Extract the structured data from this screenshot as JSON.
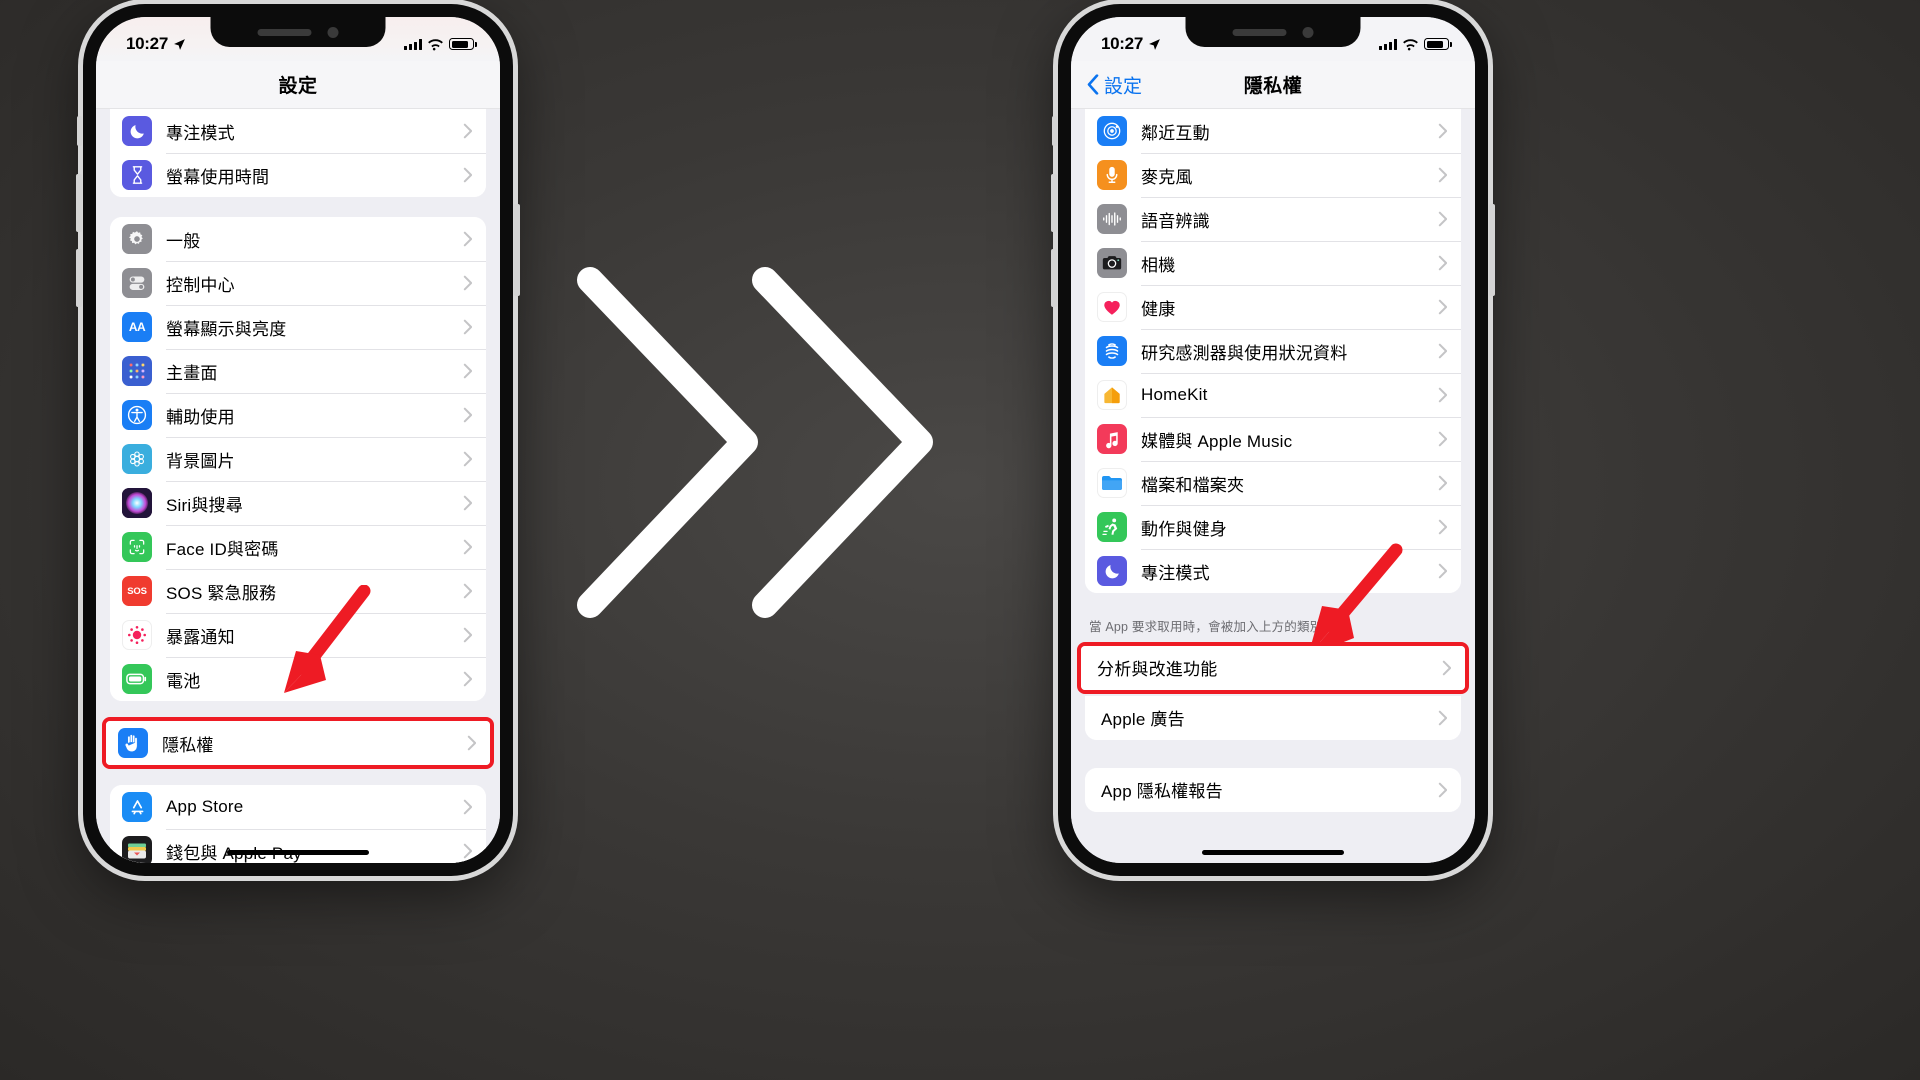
{
  "scene": {
    "background_color": "#3a3836",
    "highlight_color": "#ee1b24",
    "arrow_color": "#ee1b24",
    "chevron_color": "#ffffff"
  },
  "left_phone": {
    "status_bar": {
      "time": "10:27",
      "location_icon": "location-arrow-icon",
      "signal_icon": "signal-bars-icon",
      "wifi_icon": "wifi-icon",
      "battery_icon": "battery-icon"
    },
    "nav": {
      "title": "設定"
    },
    "groups": [
      {
        "rows": [
          {
            "label": "專注模式",
            "icon": "focus-moon-icon",
            "icon_bg": "#5a5ae0"
          },
          {
            "label": "螢幕使用時間",
            "icon": "screen-time-hourglass-icon",
            "icon_bg": "#5a5ae0"
          }
        ]
      },
      {
        "rows": [
          {
            "label": "一般",
            "icon": "gear-icon",
            "icon_bg": "#8e8e93"
          },
          {
            "label": "控制中心",
            "icon": "control-center-toggles-icon",
            "icon_bg": "#8e8e93"
          },
          {
            "label": "螢幕顯示與亮度",
            "icon": "display-brightness-aa-icon",
            "icon_bg": "#1a7ef5"
          },
          {
            "label": "主畫面",
            "icon": "home-screen-grid-icon",
            "icon_bg": "#3a5fd0"
          },
          {
            "label": "輔助使用",
            "icon": "accessibility-icon",
            "icon_bg": "#1a7ef5"
          },
          {
            "label": "背景圖片",
            "icon": "wallpaper-flower-icon",
            "icon_bg": "#3aaede"
          },
          {
            "label": "Siri與搜尋",
            "icon": "siri-orb-icon",
            "icon_bg": "#22143a"
          },
          {
            "label": "Face ID與密碼",
            "icon": "face-id-icon",
            "icon_bg": "#34c759"
          },
          {
            "label": "SOS 緊急服務",
            "icon": "sos-icon",
            "icon_bg": "#f03b2f"
          },
          {
            "label": "暴露通知",
            "icon": "exposure-notification-icon",
            "icon_bg": "#ffffff"
          },
          {
            "label": "電池",
            "icon": "battery-green-icon",
            "icon_bg": "#34c759"
          }
        ]
      },
      {
        "highlighted": true,
        "rows": [
          {
            "label": "隱私權",
            "icon": "privacy-hand-icon",
            "icon_bg": "#1a7ef5"
          }
        ]
      },
      {
        "rows": [
          {
            "label": "App Store",
            "icon": "app-store-icon",
            "icon_bg": "#1a8cf5"
          },
          {
            "label": "錢包與 Apple Pay",
            "icon": "wallet-icon",
            "icon_bg": "#1c1c1e"
          }
        ]
      }
    ]
  },
  "right_phone": {
    "status_bar": {
      "time": "10:27",
      "location_icon": "location-arrow-icon",
      "signal_icon": "signal-bars-icon",
      "wifi_icon": "wifi-icon",
      "battery_icon": "battery-icon"
    },
    "nav": {
      "back_label": "設定",
      "title": "隱私權",
      "back_icon": "chevron-left-icon"
    },
    "groups": [
      {
        "rows": [
          {
            "label": "鄰近互動",
            "icon": "nearby-interactions-icon",
            "icon_bg": "#1a7ef5"
          },
          {
            "label": "麥克風",
            "icon": "microphone-icon",
            "icon_bg": "#f5901e"
          },
          {
            "label": "語音辨識",
            "icon": "speech-recognition-icon",
            "icon_bg": "#8e8e93"
          },
          {
            "label": "相機",
            "icon": "camera-icon",
            "icon_bg": "#8e8e93"
          },
          {
            "label": "健康",
            "icon": "health-heart-icon",
            "icon_bg": "#ffffff"
          },
          {
            "label": "研究感測器與使用狀況資料",
            "icon": "research-sensor-icon",
            "icon_bg": "#1a7ef5"
          },
          {
            "label": "HomeKit",
            "icon": "homekit-house-icon",
            "icon_bg": "#ffffff"
          },
          {
            "label": "媒體與 Apple Music",
            "icon": "apple-music-icon",
            "icon_bg": "#f33a5a"
          },
          {
            "label": "檔案和檔案夾",
            "icon": "files-folder-icon",
            "icon_bg": "#ffffff"
          },
          {
            "label": "動作與健身",
            "icon": "motion-fitness-icon",
            "icon_bg": "#34c759"
          },
          {
            "label": "專注模式",
            "icon": "focus-moon-icon",
            "icon_bg": "#5a5ae0"
          }
        ]
      }
    ],
    "caption": "當 App 要求取用時，會被加入上方的類別。",
    "highlighted_group": {
      "highlighted": true,
      "rows": [
        {
          "label": "分析與改進功能",
          "icon": "none"
        }
      ]
    },
    "after_rows": [
      {
        "label": "Apple 廣告",
        "icon": "none"
      }
    ],
    "last_group": {
      "rows": [
        {
          "label": "App 隱私權報告",
          "icon": "none"
        }
      ]
    }
  }
}
